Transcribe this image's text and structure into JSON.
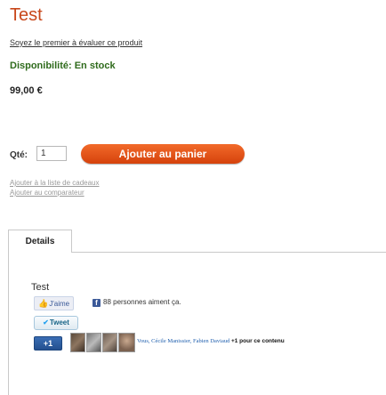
{
  "product": {
    "title": "Test",
    "review_link": "Soyez le premier à évaluer ce produit",
    "availability": "Disponibilité: En stock",
    "price": "99,00 €"
  },
  "cart": {
    "qty_label": "Qté:",
    "qty_value": "1",
    "add_button": "Ajouter au panier",
    "wishlist_link": "Ajouter à la liste de cadeaux",
    "compare_link": "Ajouter au comparateur"
  },
  "tabs": [
    {
      "label": "Details"
    }
  ],
  "details": {
    "title": "Test"
  },
  "social": {
    "like_label": "J'aime",
    "like_icon": "thumbs-up-icon",
    "fb_count_text": "88 personnes aiment ça.",
    "fb_icon": "facebook-icon",
    "tweet_label": "Tweet",
    "tweet_icon": "twitter-bird-icon",
    "plusone_label": "+1",
    "plusone_people": "Vous, Cécile Manissier, Fabien Daviaud",
    "plusone_suffix": "+1 pour ce contenu",
    "colors": {
      "accent_orange": "#e0531a",
      "title": "#c8471a",
      "availability": "#2f6b1c",
      "facebook": "#3b5998",
      "twitter": "#186487",
      "google": "#24508f"
    }
  }
}
